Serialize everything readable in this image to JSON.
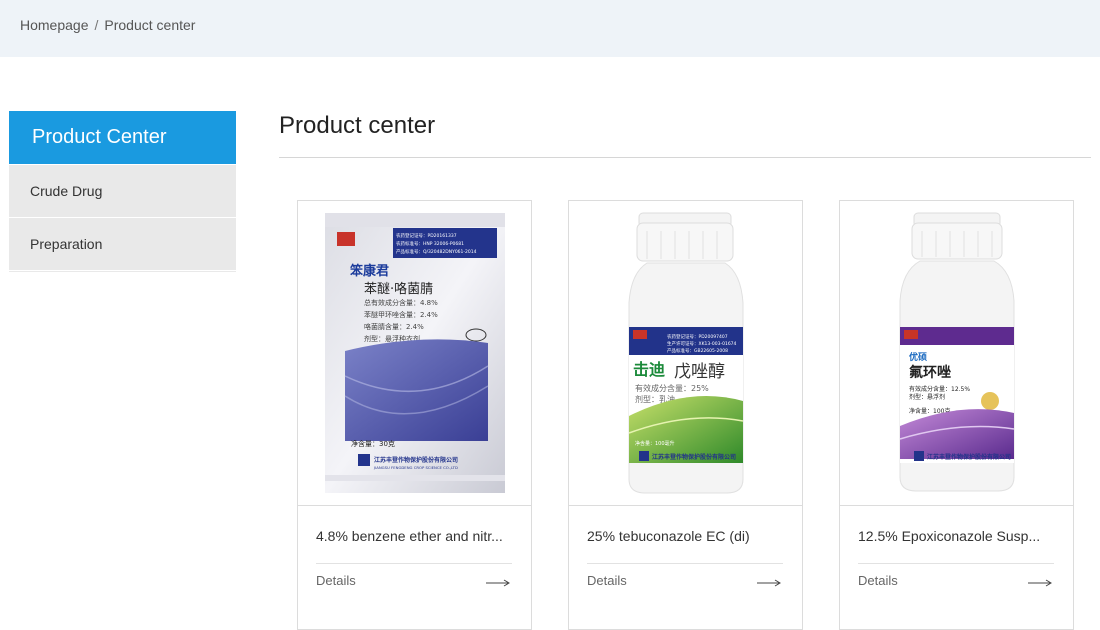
{
  "breadcrumb": {
    "home": "Homepage",
    "separator": "/",
    "current": "Product center"
  },
  "sidebar": {
    "title": "Product Center",
    "items": [
      {
        "label": "Crude Drug"
      },
      {
        "label": "Preparation"
      }
    ]
  },
  "main": {
    "title": "Product center"
  },
  "products": [
    {
      "name": "4.8% benzene ether and nitr...",
      "details": "Details",
      "package": {
        "brand": "笨康君",
        "title": "苯醚·咯菌腈",
        "line1": "总有效成分含量：4.8%",
        "line2": "苯醚甲环唑含量：2.4%",
        "line3": "咯菌腈含量：2.4%",
        "line4": "剂型：悬浮种衣剂",
        "net": "净含量：30克",
        "company": "江苏丰登作物保护股份有限公司",
        "company_en": "JIANGSU FENGDENG CROP SCIENCE CO.,LTD",
        "reg1": "农药登记证号：PD20161337",
        "reg2": "农药标准号：HNP 32006-P0681",
        "reg3": "产品标准号：Q/320482DNY061-2014"
      }
    },
    {
      "name": "25% tebuconazole EC (di)",
      "details": "Details",
      "package": {
        "brand": "击迪",
        "title": "戊唑醇",
        "line1": "有效成分含量：25%",
        "line2": "剂型：乳油",
        "net": "净含量：100毫升",
        "company": "江苏丰登作物保护股份有限公司",
        "reg1": "农药登记证号：PD20097407",
        "reg2": "生产许可证号：XK13-003-01674",
        "reg3": "产品标准号：GB22605-2008"
      }
    },
    {
      "name": "12.5% Epoxiconazole Susp...",
      "details": "Details",
      "package": {
        "brand": "优硕",
        "title": "氟环唑",
        "line1": "有效成分含量：12.5%",
        "line2": "剂型：悬浮剂",
        "net": "净含量：100克",
        "company": "江苏丰登作物保护股份有限公司"
      }
    }
  ]
}
